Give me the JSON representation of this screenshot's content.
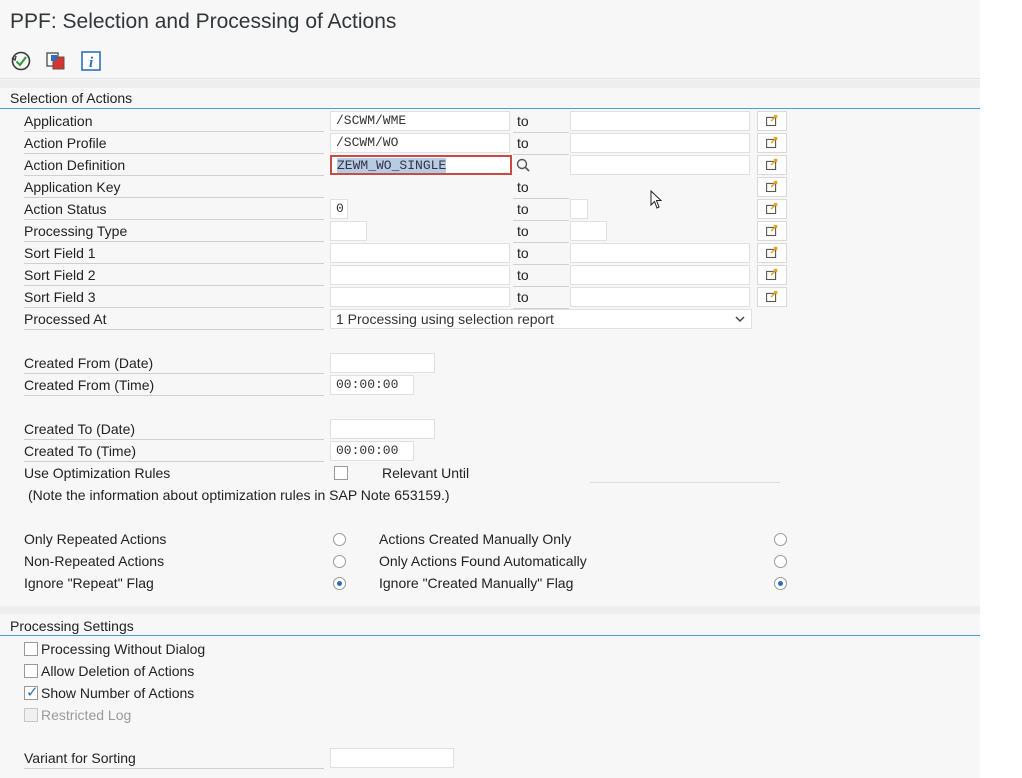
{
  "window": {
    "title": "PPF: Selection and Processing of Actions"
  },
  "toolbar": {
    "execute_icon": "execute-icon",
    "variants_icon": "get-variant-icon",
    "info_icon": "info-icon",
    "info_glyph": "i"
  },
  "selection": {
    "header": "Selection of Actions",
    "to_label": "to",
    "application": {
      "label": "Application",
      "value": "/SCWM/WME"
    },
    "action_profile": {
      "label": "Action Profile",
      "value": "/SCWM/WO"
    },
    "action_definition": {
      "label": "Action Definition",
      "value": "ZEWM_WO_SINGLE"
    },
    "application_key": {
      "label": "Application Key",
      "value": ""
    },
    "action_status": {
      "label": "Action Status",
      "value": "0"
    },
    "processing_type": {
      "label": "Processing Type",
      "value": ""
    },
    "sort_field_1": {
      "label": "Sort Field 1"
    },
    "sort_field_2": {
      "label": "Sort Field 2"
    },
    "sort_field_3": {
      "label": "Sort Field 3"
    },
    "processed_at": {
      "label": "Processed At",
      "value": "1 Processing using selection report"
    },
    "created_from_date": {
      "label": "Created From (Date)",
      "value": ""
    },
    "created_from_time": {
      "label": "Created From (Time)",
      "value": "00:00:00"
    },
    "created_to_date": {
      "label": "Created To (Date)",
      "value": ""
    },
    "created_to_time": {
      "label": "Created To (Time)",
      "value": "00:00:00"
    },
    "use_optimization_rules": {
      "label": "Use Optimization Rules",
      "checked": false
    },
    "relevant_until": {
      "label": "Relevant Until"
    },
    "note": "(Note the information about optimization rules in SAP Note 653159.)",
    "repeat_options": [
      {
        "label": "Only Repeated Actions",
        "selected": false
      },
      {
        "label": "Non-Repeated Actions",
        "selected": false
      },
      {
        "label": "Ignore \"Repeat\" Flag",
        "selected": true
      }
    ],
    "manual_options": [
      {
        "label": "Actions Created Manually Only",
        "selected": false
      },
      {
        "label": "Only Actions Found Automatically",
        "selected": false
      },
      {
        "label": "Ignore \"Created Manually\" Flag",
        "selected": true
      }
    ]
  },
  "processing": {
    "header": "Processing Settings",
    "options": [
      {
        "label": "Processing Without Dialog",
        "checked": false,
        "enabled": true
      },
      {
        "label": "Allow Deletion of Actions",
        "checked": false,
        "enabled": true
      },
      {
        "label": "Show Number of Actions",
        "checked": true,
        "enabled": true
      },
      {
        "label": "Restricted Log",
        "checked": false,
        "enabled": false
      }
    ],
    "variant_for_sorting": {
      "label": "Variant for Sorting",
      "value": ""
    }
  },
  "colors": {
    "accent": "#4f9bd1",
    "highlight_border": "#c94b45",
    "radio_on": "#2d6fb7"
  }
}
